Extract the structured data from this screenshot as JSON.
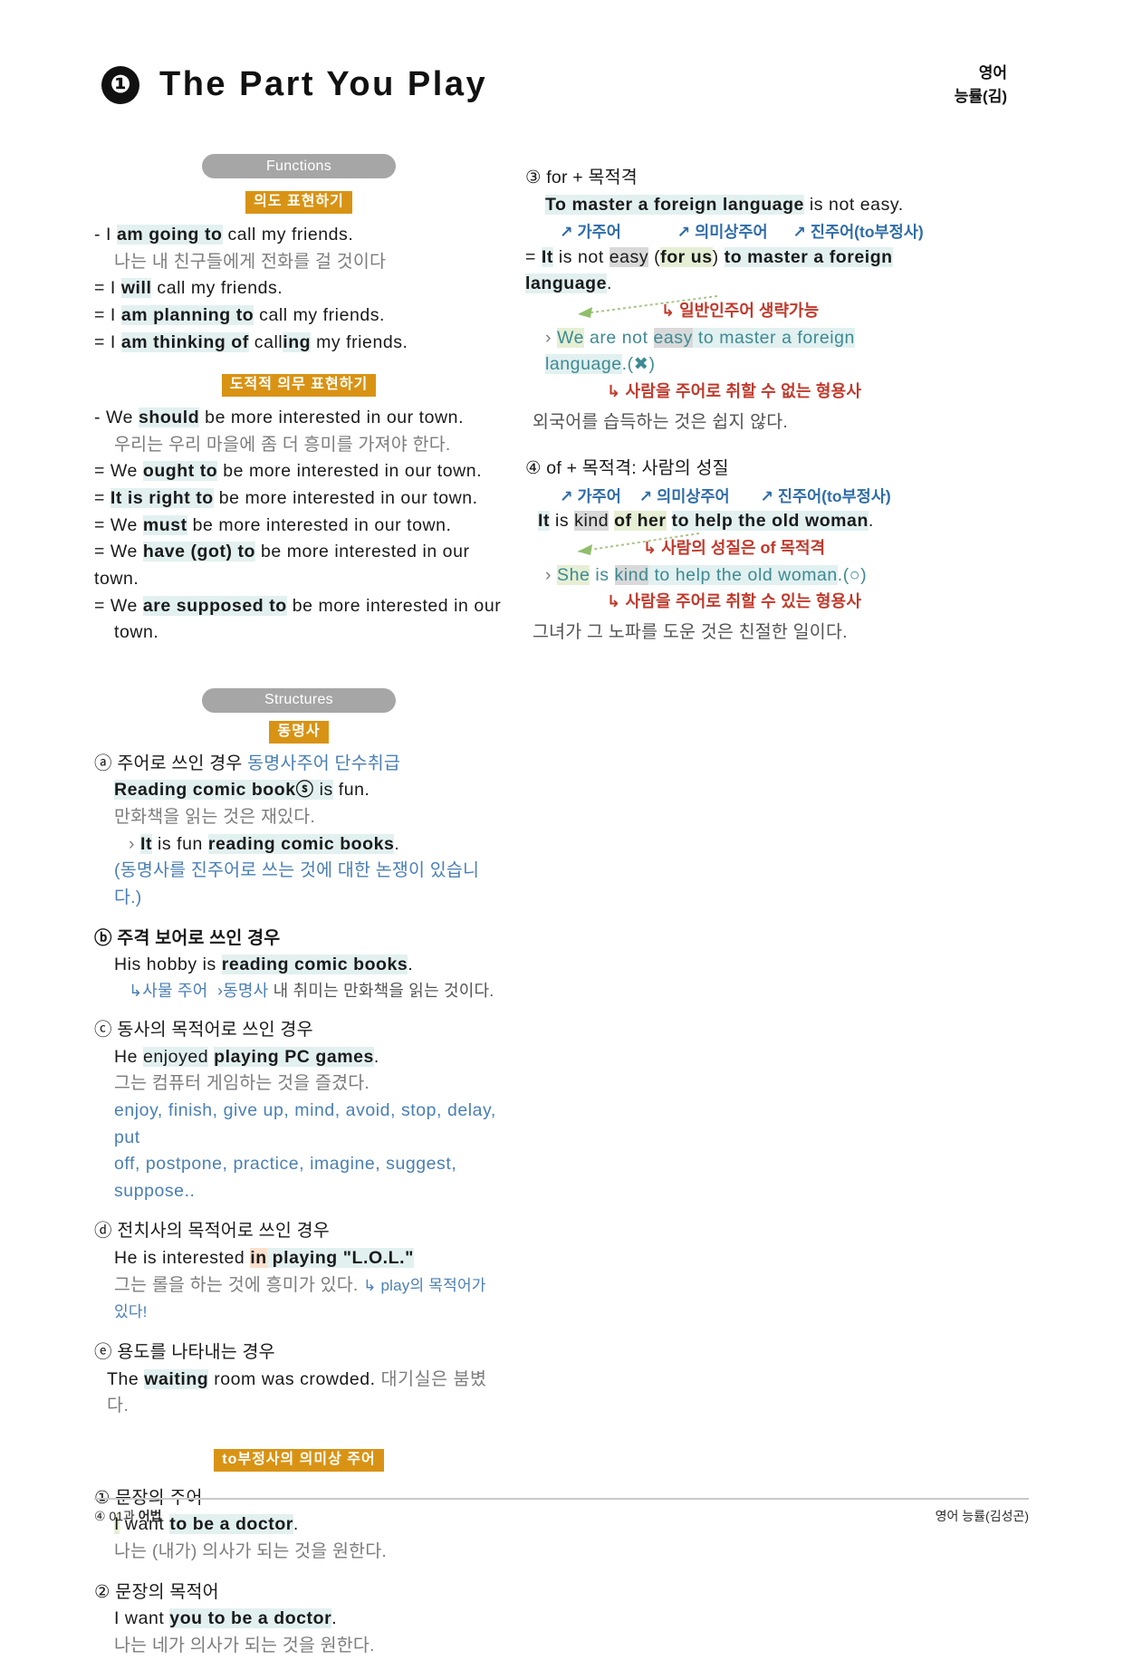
{
  "header": {
    "unit_number": "❶",
    "title": "The Part You Play",
    "subject": "영어",
    "publisher": "능률(김)"
  },
  "sections": {
    "functions_pill": "Functions",
    "structures_pill": "Structures",
    "badge_intent": "의도 표현하기",
    "badge_duty": "도적적 의무 표현하기",
    "badge_gerund": "동명사",
    "badge_tosubject": "to부정사의 의미상 주어"
  },
  "intent": {
    "l1_pre": "-  I ",
    "l1_hl": "am going to",
    "l1_post": " call my friends.",
    "l1_ko": "나는 내 친구들에게 전화를 걸 것이다",
    "l2_pre": "=  I ",
    "l2_hl": "will",
    "l2_post": " call my friends.",
    "l3_pre": "=  I ",
    "l3_hl": "am planning to",
    "l3_post": " call my friends.",
    "l4_pre": "=  I ",
    "l4_hl": "am thinking of",
    "l4_mid": " call",
    "l4_hl2": "ing",
    "l4_post": " my friends."
  },
  "duty": {
    "l1_pre": "-  We ",
    "l1_hl": "should",
    "l1_post": " be more interested in our town.",
    "l1_ko": "우리는 우리 마을에 좀 더 흥미를 가져야 한다.",
    "l2_pre": "=  We ",
    "l2_hl": "ought to",
    "l2_post": " be more interested in our town.",
    "l3_pre": "=  ",
    "l3_hl": "It is right to",
    "l3_post": " be more interested in our town.",
    "l4_pre": "=  We ",
    "l4_hl": "must",
    "l4_post": " be more interested in our town.",
    "l5_pre": "=  We ",
    "l5_hl": "have (got) to",
    "l5_post": " be more interested in our town.",
    "l6_pre": "=  We ",
    "l6_hl": "are supposed to",
    "l6_post": " be  more  interested  in  our",
    "l6_cont": "town."
  },
  "gerund": {
    "a_label": "ⓐ 주어로 쓰인 경우 ",
    "a_note": "동명사주어 단수취급",
    "a_sent_hl": "Reading comic book",
    "a_sent_circle": "ⓢ",
    "a_sent_hl2": " is",
    "a_sent_post": " fun.",
    "a_ko": "만화책을 읽는 것은 재있다.",
    "a_alt_marker": "›",
    "a_alt_hl": "It",
    "a_alt_mid": " is fun ",
    "a_alt_hl2": "reading comic books",
    "a_alt_post": ".",
    "a_paren": "(동명사를 진주어로 쓰는 것에 대한 논쟁이 있습니다.)",
    "b_label": "ⓑ 주격 보어로 쓰인 경우",
    "b_sent_pre": "His hobby is ",
    "b_sent_hl": "reading comic books",
    "b_sent_post": ".",
    "b_note1": "↳사물 주어",
    "b_note2": "›동명사",
    "b_ko": " 내 취미는 만화책을 읽는 것이다.",
    "c_label": "ⓒ 동사의 목적어로 쓰인 경우",
    "c_sent_pre": "He ",
    "c_sent_gray": "enjoyed",
    "c_sent_mid": " ",
    "c_sent_hl": "playing PC games",
    "c_sent_post": ".",
    "c_ko": "그는 컴퓨터 게임하는 것을 즐겼다.",
    "c_verbs_line1": "enjoy, finish, give up, mind, avoid, stop, delay, put",
    "c_verbs_line2": "off, postpone, practice, imagine, suggest, suppose..",
    "d_label": "ⓓ 전치사의 목적어로 쓰인 경우",
    "d_sent_pre": "He is interested ",
    "d_sent_peach": "in",
    "d_sent_hl": " playing \"L.O.L.\"",
    "d_ko": "그는 롤을 하는 것에 흥미가 있다. ",
    "d_note": "↳ play의 목적어가 있다!",
    "e_label": "ⓔ 용도를 나타내는 경우",
    "e_sent_pre": "The ",
    "e_sent_hl": "waiting",
    "e_sent_post": " room was crowded. ",
    "e_ko": "대기실은 붐볐다."
  },
  "tosubject": {
    "n1_label": "① 문장의 주어",
    "n1_pre": "I",
    "n1_mid": " want ",
    "n1_hl": "to be a doctor",
    "n1_post": ".",
    "n1_ko": "나는 (내가) 의사가 되는 것을 원한다.",
    "n2_label": "② 문장의 목적어",
    "n2_pre": "I want ",
    "n2_hl": "you to be a doctor",
    "n2_post": ".",
    "n2_ko": "나는 네가 의사가 되는 것을 원한다."
  },
  "right": {
    "n3_label": "③ for + 목적격",
    "n3_sent_hl": "To master a foreign language",
    "n3_sent_post": " is not easy.",
    "n3_ann1": "↗ 가주어",
    "n3_ann2": "↗ 의미상주어",
    "n3_ann3": "↗ 진주어(to부정사)",
    "n3_eq_pre": "=  ",
    "n3_eq_hl_it": "It",
    "n3_eq_mid1": " is not ",
    "n3_eq_gray": "easy",
    "n3_eq_mid2": " (",
    "n3_eq_green": "for us",
    "n3_eq_mid3": ") ",
    "n3_eq_hl2": "to master a foreign language",
    "n3_eq_post": ".",
    "n3_red": "↳ 일반인주어 생략가능",
    "n3_wrong_marker": "›",
    "n3_wrong_green": "We",
    "n3_wrong_mid": " are not ",
    "n3_wrong_gray": "easy",
    "n3_wrong_hl": " to master a foreign language",
    "n3_wrong_post": ".(✖)",
    "n3_red2": "↳ 사람을 주어로 취할 수 없는 형용사",
    "n3_ko": "외국어를 습득하는 것은 쉽지 않다.",
    "n4_label": "④ of + 목적격: 사람의 성질",
    "n4_ann1": "↗ 가주어",
    "n4_ann2": "↗ 의미상주어",
    "n4_ann3": "↗ 진주어(to부정사)",
    "n4_pre_hl": "It",
    "n4_mid1": " is ",
    "n4_gray": "kind",
    "n4_mid2": " ",
    "n4_green": "of her",
    "n4_mid3": " ",
    "n4_hl2": "to help the old woman",
    "n4_post": ".",
    "n4_red": "↳ 사람의 성질은 of 목적격",
    "n4_ok_marker": "›",
    "n4_ok_green": "She",
    "n4_ok_mid": " is ",
    "n4_ok_gray": "kind",
    "n4_ok_hl": " to help the old woman",
    "n4_ok_post": ".(○)",
    "n4_red2": "↳ 사람을 주어로 취할 수 있는 형용사",
    "n4_ko": "그녀가 그 노파를 도운 것은 친절한 일이다."
  },
  "footer": {
    "left_num": "④",
    "left_text": " 01과 ",
    "left_bold": "어법",
    "right_text": "영어 능률(김성곤)"
  },
  "colors": {
    "badge_orange": "#d99314",
    "pill_gray": "#a6a6a6",
    "highlight_cyan": "#e2f0f0",
    "highlight_green": "#e6efd4",
    "highlight_gray": "#d9d9d9",
    "highlight_peach": "#fbe0cd",
    "blue_note": "#4a7fb5",
    "blue_annotation": "#2e6ca8",
    "red_annotation": "#c0392b",
    "korean_gray": "#7d7d7d"
  }
}
